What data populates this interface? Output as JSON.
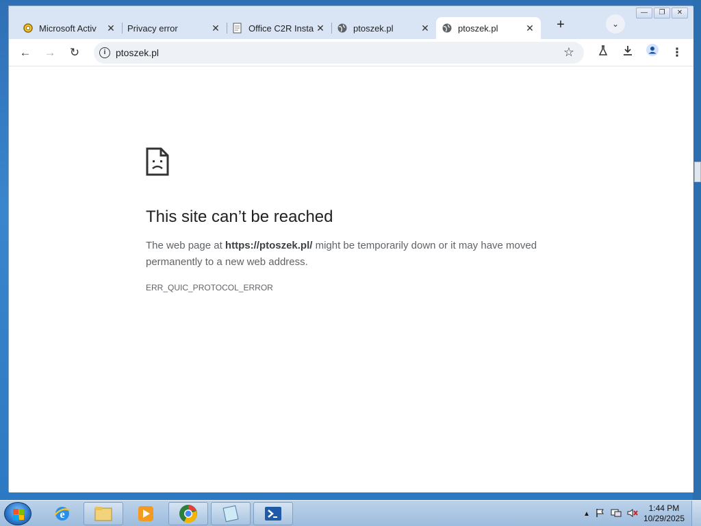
{
  "browser": {
    "tabs": [
      {
        "title": "Microsoft Activ",
        "favicon": "gear-icon",
        "active": false
      },
      {
        "title": "Privacy error",
        "favicon": "none",
        "active": false
      },
      {
        "title": "Office C2R Insta",
        "favicon": "document-icon",
        "active": false
      },
      {
        "title": "ptoszek.pl",
        "favicon": "globe-icon",
        "active": false
      },
      {
        "title": "ptoszek.pl",
        "favicon": "globe-icon",
        "active": true
      }
    ],
    "new_tab_symbol": "+",
    "close_symbol": "✕",
    "address": "ptoszek.pl"
  },
  "error_page": {
    "title": "This site can’t be reached",
    "desc_prefix": "The web page at ",
    "desc_url": "https://ptoszek.pl/",
    "desc_suffix": " might be temporarily down or it may have moved permanently to a new web address.",
    "code": "ERR_QUIC_PROTOCOL_ERROR"
  },
  "taskbar": {
    "apps": [
      "internet-explorer",
      "file-explorer",
      "media-player",
      "chrome",
      "notepad",
      "powershell"
    ],
    "time": "1:44 PM",
    "date": "10/29/2025"
  },
  "colors": {
    "title_text": "#202124",
    "body_text": "#5f6368",
    "titlebar": "#d9e5f5"
  }
}
